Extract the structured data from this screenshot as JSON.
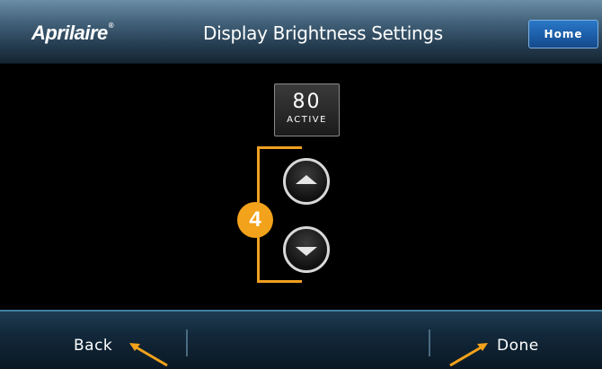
{
  "header": {
    "logo_text": "Aprilaire",
    "logo_mark": "®",
    "title": "Display Brightness Settings",
    "home_label": "Home"
  },
  "setting": {
    "value": "80",
    "status": "ACTIVE",
    "callout_number": "4"
  },
  "controls": {
    "up_icon": "up-triangle-icon",
    "down_icon": "down-triangle-icon"
  },
  "footer": {
    "back_label": "Back",
    "done_label": "Done"
  },
  "colors": {
    "accent_orange": "#f3a21b",
    "home_button": "#1c5ea8",
    "header_blue": "#42627a",
    "footer_blue": "#12283a"
  }
}
